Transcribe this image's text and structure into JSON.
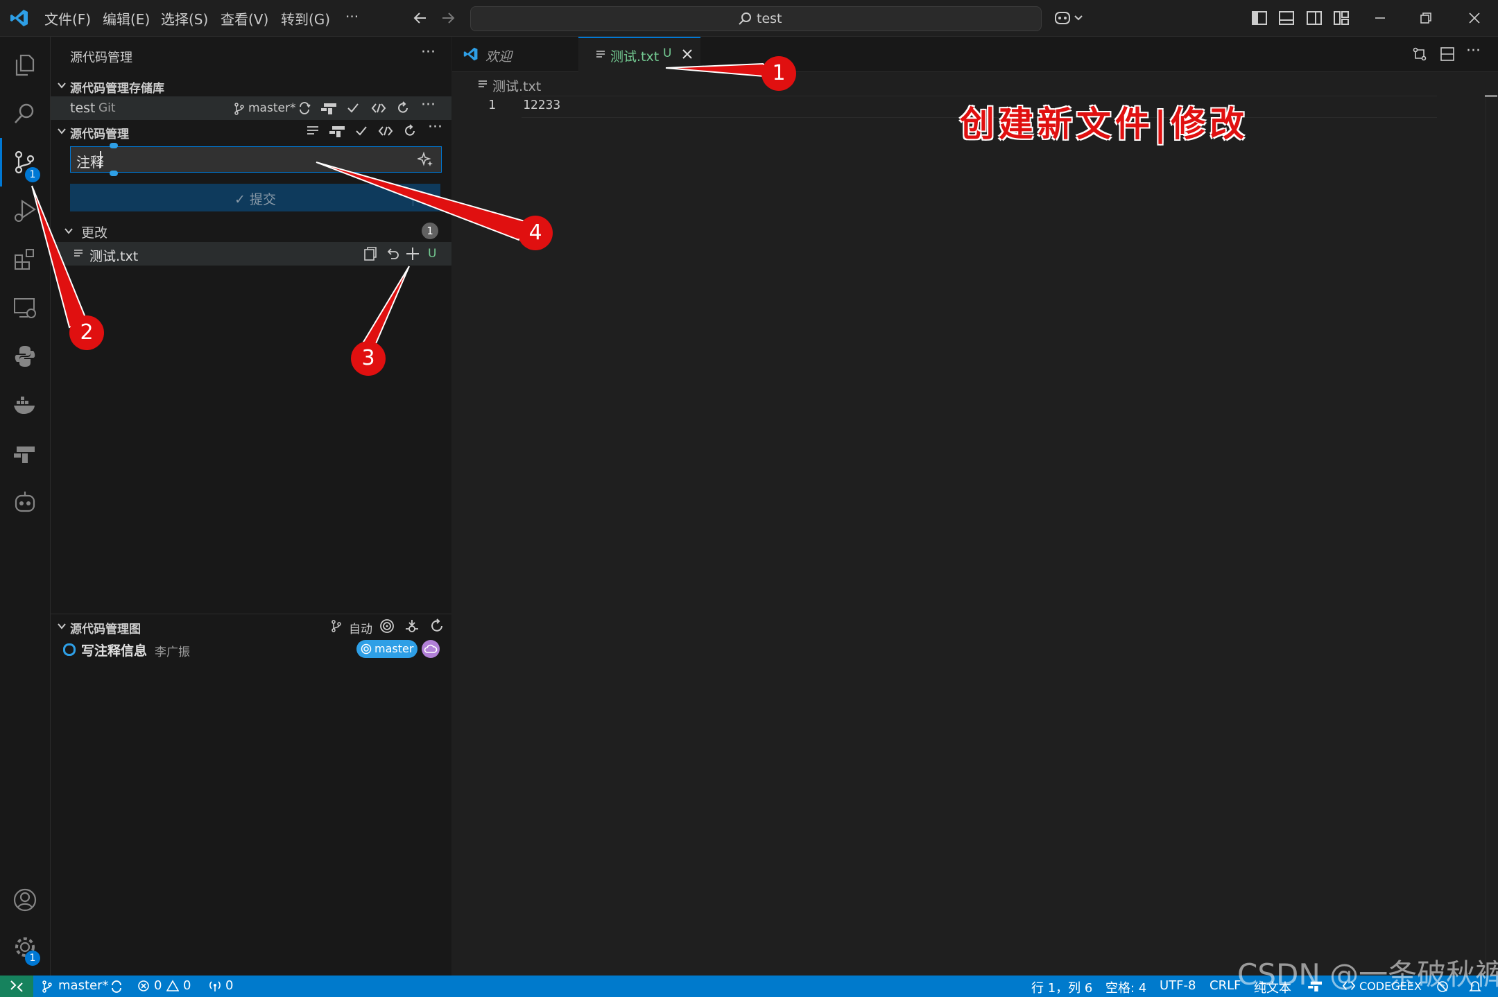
{
  "menu": [
    "文件(F)",
    "编辑(E)",
    "选择(S)",
    "查看(V)",
    "转到(G)",
    "···"
  ],
  "command_center": {
    "text": "test"
  },
  "activity": {
    "scm_badge": "1",
    "settings_badge": "1"
  },
  "sidebar": {
    "title": "源代码管理",
    "repos_header": "源代码管理存储库",
    "repo": {
      "name": "test",
      "type": "Git",
      "branch": "master*"
    },
    "scm_header": "源代码管理",
    "commit_input": {
      "value": "注释"
    },
    "commit_button": "✓ 提交",
    "changes": {
      "label": "更改",
      "count": "1"
    },
    "file": {
      "name": "测试.txt",
      "status": "U"
    },
    "graph": {
      "header": "源代码管理图",
      "auto_label": "自动",
      "entry": {
        "message": "写注释信息",
        "author": "李广振",
        "branch": "master"
      }
    }
  },
  "tabs": [
    {
      "label": "欢迎"
    },
    {
      "label": "测试.txt",
      "status": "U"
    }
  ],
  "editor": {
    "breadcrumb": "测试.txt",
    "lines": [
      {
        "num": "1",
        "text": "12233"
      }
    ]
  },
  "annotations": {
    "title": "创建新文件|修改",
    "callouts": [
      "1",
      "2",
      "3",
      "4"
    ]
  },
  "statusbar": {
    "branch": "master*",
    "errors": "0",
    "warnings": "0",
    "ports": "0",
    "position": "行 1，列 6",
    "spaces": "空格: 4",
    "encoding": "UTF-8",
    "eol": "CRLF",
    "language": "纯文本",
    "codegeex": "CODEGEEX"
  },
  "watermark": "CSDN @一条破秋裤",
  "colors": {
    "accent": "#0078d4",
    "status": "#007acc",
    "annotation": "#e01010",
    "untracked": "#73c991"
  }
}
